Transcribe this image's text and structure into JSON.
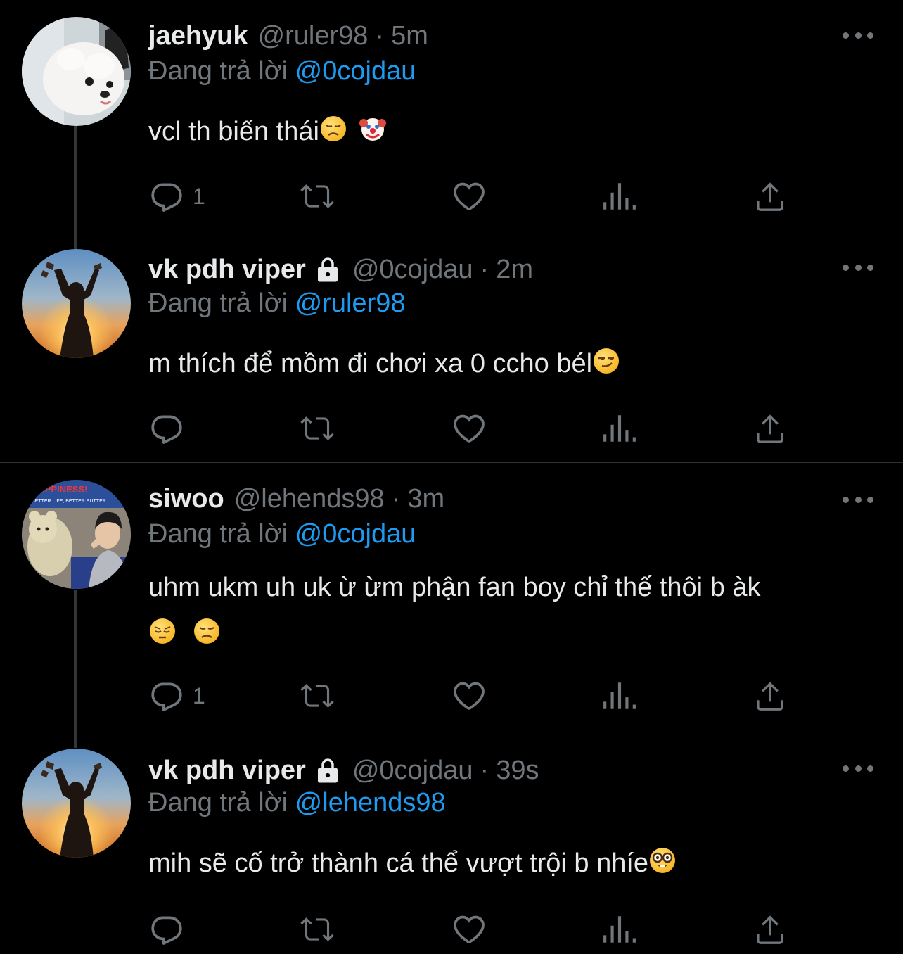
{
  "tweets": [
    {
      "name": "jaehyuk",
      "handle": "@ruler98",
      "separator": "·",
      "time": "5m",
      "locked": false,
      "replying_prefix": "Đang trả lời",
      "replying_to": "@0cojdau",
      "text": "vcl th biến thái",
      "emojis": [
        "disappointed-face",
        "clown-face"
      ],
      "reply_count": "1",
      "avatar": "white-puppy"
    },
    {
      "name": "vk pdh viper",
      "handle": "@0cojdau",
      "separator": "·",
      "time": "2m",
      "locked": true,
      "replying_prefix": "Đang trả lời",
      "replying_to": "@ruler98",
      "text": "m thích để mồm đi chơi xa 0 ccho bél",
      "emojis": [
        "smirking-face"
      ],
      "reply_count": "",
      "avatar": "silhouette-sunset"
    },
    {
      "name": "siwoo",
      "handle": "@lehends98",
      "separator": "·",
      "time": "3m",
      "locked": false,
      "replying_prefix": "Đang trả lời",
      "replying_to": "@0cojdau",
      "text": "uhm ukm uh uk ừ ừm phận fan boy chỉ thế thôi b àk",
      "emojis": [
        "pensive-face",
        "disappointed-face"
      ],
      "reply_count": "1",
      "avatar": "person-with-plush-bear",
      "avatar_text": "HAPPINESS BETTER LIFE, BETTER BUTTER"
    },
    {
      "name": "vk pdh viper",
      "handle": "@0cojdau",
      "separator": "·",
      "time": "39s",
      "locked": true,
      "replying_prefix": "Đang trả lời",
      "replying_to": "@lehends98",
      "text": "mih sẽ cố trở thành cá thể vượt trội b nhíe",
      "emojis": [
        "nerd-face"
      ],
      "reply_count": "",
      "avatar": "silhouette-sunset"
    }
  ],
  "colors": {
    "background": "#000000",
    "text": "#e7e9ea",
    "secondary": "#71767b",
    "mention": "#1d9bf0",
    "divider": "#2f3336"
  }
}
